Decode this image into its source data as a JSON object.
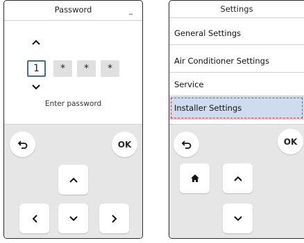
{
  "password_screen": {
    "title": "Password",
    "digits": [
      "1",
      "*",
      "*",
      "*"
    ],
    "prompt": "Enter password",
    "buttons": {
      "ok": "OK"
    }
  },
  "settings_screen": {
    "title": "Settings",
    "items": [
      {
        "label": "General Settings"
      },
      {
        "label": "Air Conditioner Settings"
      },
      {
        "label": "Service"
      },
      {
        "label": "Installer Settings"
      }
    ],
    "buttons": {
      "ok": "OK"
    }
  },
  "icons": {
    "back": "back-arrow-icon",
    "home": "home-icon",
    "up": "chevron-up-icon",
    "down": "chevron-down-icon",
    "left": "chevron-left-icon",
    "right": "chevron-right-icon"
  },
  "colors": {
    "selection_bg": "#cfdcef",
    "selection_outline": "#d23a3a",
    "active_digit_border": "#3f6da8",
    "keypad_bg": "#e6e6e6"
  }
}
